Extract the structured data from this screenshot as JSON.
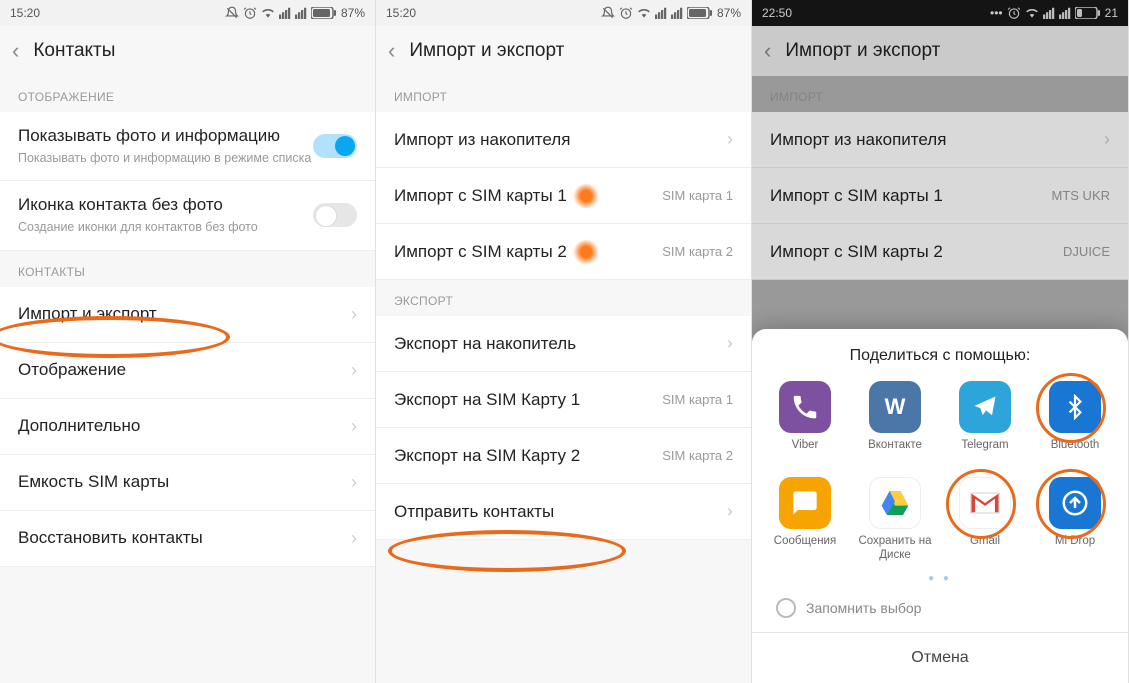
{
  "screen1": {
    "status": {
      "time": "15:20",
      "battery": "87%"
    },
    "title": "Контакты",
    "sections": {
      "display_label": "ОТОБРАЖЕНИЕ",
      "contacts_label": "КОНТАКТЫ"
    },
    "photo_info_title": "Показывать фото и информацию",
    "photo_info_sub": "Показывать фото и информацию в режиме списка",
    "icon_nophoto_title": "Иконка контакта без фото",
    "icon_nophoto_sub": "Создание иконки для контактов без фото",
    "items": {
      "import_export": "Импорт и экспорт",
      "display": "Отображение",
      "more": "Дополнительно",
      "sim_capacity": "Емкость SIM карты",
      "restore": "Восстановить контакты"
    }
  },
  "screen2": {
    "status": {
      "time": "15:20",
      "battery": "87%"
    },
    "title": "Импорт и экспорт",
    "import_label": "ИМПОРТ",
    "export_label": "ЭКСПОРТ",
    "import_storage": "Импорт из накопителя",
    "import_sim1": "Импорт с SIM карты 1",
    "import_sim1_val": "SIM карта 1",
    "import_sim2": "Импорт с SIM карты 2",
    "import_sim2_val": "SIM карта 2",
    "export_storage": "Экспорт на накопитель",
    "export_sim1": "Экспорт на SIM Карту 1",
    "export_sim1_val": "SIM карта 1",
    "export_sim2": "Экспорт на SIM Карту 2",
    "export_sim2_val": "SIM карта 2",
    "send_contacts": "Отправить контакты"
  },
  "screen3": {
    "status": {
      "time": "22:50",
      "battery": "21"
    },
    "title": "Импорт и экспорт",
    "import_label": "ИМПОРТ",
    "import_storage": "Импорт из накопителя",
    "import_sim1": "Импорт с SIM карты 1",
    "import_sim1_val": "MTS UKR",
    "import_sim2": "Импорт с SIM карты 2",
    "import_sim2_val": "DJUICE",
    "sheet_title": "Поделиться с помощью:",
    "apps": {
      "viber": "Viber",
      "vk": "Вконтакте",
      "tg": "Telegram",
      "bt": "Bluetooth",
      "msg": "Сообщения",
      "drive": "Сохранить на Диске",
      "gmail": "Gmail",
      "midrop": "Mi Drop"
    },
    "remember": "Запомнить выбор",
    "cancel": "Отмена"
  }
}
